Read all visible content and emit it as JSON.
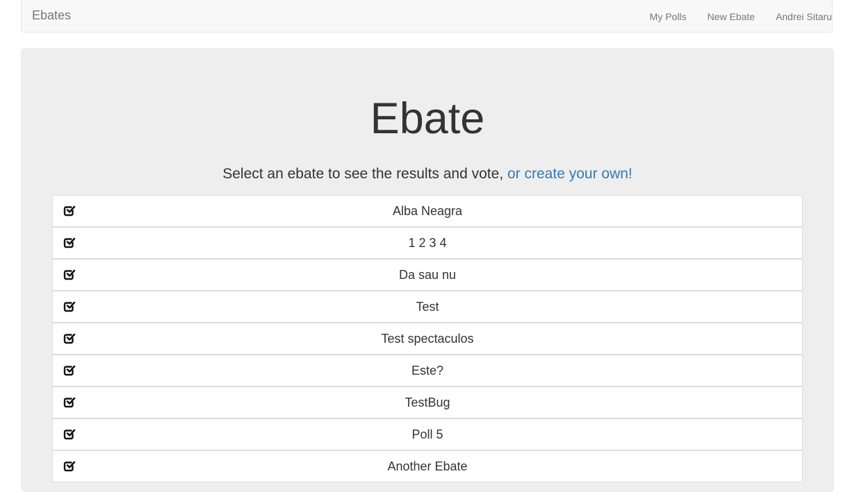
{
  "navbar": {
    "brand": "Ebates",
    "links": [
      {
        "label": "My Polls"
      },
      {
        "label": "New Ebate"
      },
      {
        "label": "Andrei Sitaru"
      }
    ]
  },
  "hero": {
    "title": "Ebate",
    "subtitle_text": "Select an ebate to see the results and vote, ",
    "subtitle_link": "or create your own!"
  },
  "polls": [
    {
      "label": "Alba Neagra",
      "icon": "check-square-icon"
    },
    {
      "label": "1 2 3 4",
      "icon": "check-square-icon"
    },
    {
      "label": "Da sau nu",
      "icon": "check-square-icon"
    },
    {
      "label": "Test",
      "icon": "check-square-icon"
    },
    {
      "label": "Test spectaculos",
      "icon": "check-square-icon"
    },
    {
      "label": "Este?",
      "icon": "check-square-icon"
    },
    {
      "label": "TestBug",
      "icon": "check-square-icon"
    },
    {
      "label": "Poll 5",
      "icon": "check-square-icon"
    },
    {
      "label": "Another Ebate",
      "icon": "check-square-icon"
    }
  ],
  "colors": {
    "navbar_bg": "#f8f8f8",
    "jumbotron_bg": "#eeeeee",
    "link": "#337ab7",
    "nav_text": "#777777"
  }
}
